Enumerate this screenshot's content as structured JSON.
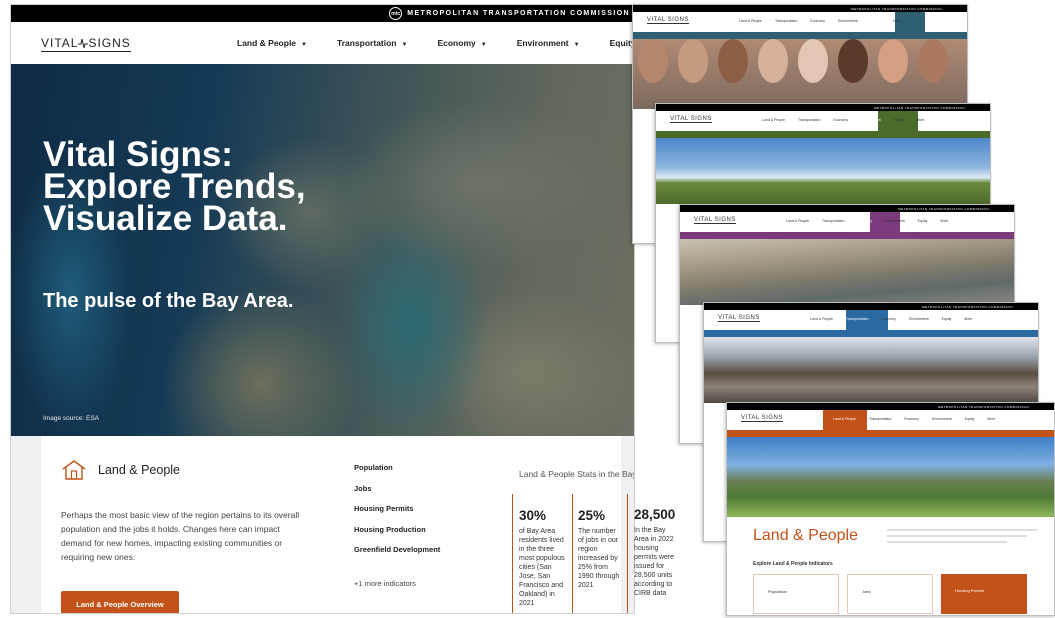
{
  "mtc": {
    "title": "METROPOLITAN TRANSPORTATION COMMISSION",
    "logo": "mtc"
  },
  "logo": {
    "left": "VITAL",
    "right": "SIGNS"
  },
  "nav": {
    "items": [
      "Land & People",
      "Transportation",
      "Economy",
      "Environment",
      "Equity"
    ]
  },
  "hero": {
    "title_line1": "Vital Signs:",
    "title_line2": "Explore Trends,",
    "title_line3": "Visualize Data.",
    "subtitle": "The pulse of the Bay Area.",
    "image_source": "Image source: ESA"
  },
  "card": {
    "icon": "house-icon",
    "title": "Land & People",
    "description": "Perhaps the most basic view of the region pertains to its overall population and the jobs it holds. Changes here can impact demand for new homes, impacting existing communities or requiring new ones.",
    "button": "Land & People Overview",
    "indicators": [
      "Population",
      "Jobs",
      "Housing Permits",
      "Housing Production",
      "Greenfield Development"
    ],
    "more_indicators": "+1 more indicators",
    "stats_title": "Land & People Stats in the Bay Area",
    "stats": [
      {
        "value": "30%",
        "text": [
          "of Bay Area",
          "residents lived",
          "in the three",
          "most populous",
          "cities (San",
          "Jose, San",
          "Francisco and",
          "Oakland) in",
          "2021"
        ]
      },
      {
        "value": "25%",
        "text": [
          "The number",
          "of jobs in our",
          "region",
          "increased by",
          "25% from",
          "1990 through",
          "2021"
        ]
      },
      {
        "value": "28,500",
        "text": [
          "In the Bay",
          "Area in 2022",
          "housing",
          "permits were",
          "issued for",
          "28,500 units",
          "according to",
          "CIRB data"
        ]
      }
    ]
  },
  "thumbs": {
    "mtc": "METROPOLITAN TRANSPORTATION COMMISSION",
    "logo": "VITAL SIGNS",
    "menu": [
      "Land & People",
      "Transportation",
      "Economy",
      "Environment",
      "Equity",
      "More"
    ],
    "land_title": "Land & People",
    "land_section": "Explore Land & People Indicators",
    "cards": [
      "Population",
      "Jobs",
      "Housing Permits"
    ],
    "colors": {
      "equity": "#2f5f73",
      "environment": "#4a6b2a",
      "economy": "#7a3a7c",
      "transportation": "#2a6aa0",
      "land": "#c25218"
    }
  }
}
